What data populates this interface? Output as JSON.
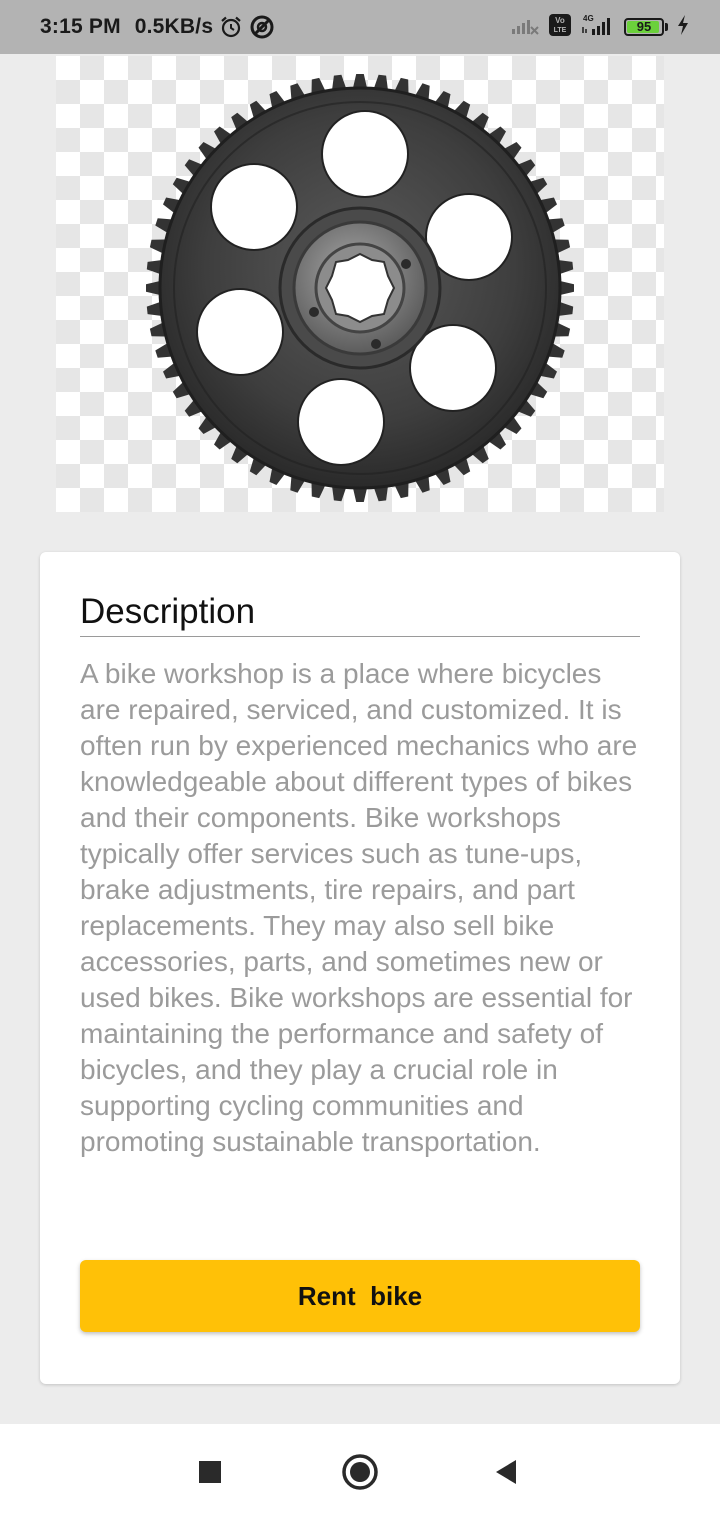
{
  "status_bar": {
    "time": "3:15 PM",
    "network_speed": "0.5KB/s",
    "network_type": "4G",
    "volte_label": "Vo LTE",
    "battery_level": "95",
    "icons": [
      "alarm-icon",
      "vpn-icon",
      "signal-icon",
      "volte-icon",
      "signal-4g-icon",
      "battery-icon",
      "charging-icon"
    ]
  },
  "hero_image": {
    "subject": "gear-image"
  },
  "card": {
    "title": "Description",
    "description": "A bike workshop is a place where bicycles are repaired, serviced, and customized. It is often run by experienced mechanics who are knowledgeable about different types of bikes and their components. Bike workshops typically offer services such as tune-ups, brake adjustments, tire repairs, and part replacements. They may also sell bike accessories, parts, and sometimes new or used bikes. Bike workshops are essential for maintaining the performance and safety of bicycles, and they play a crucial role in supporting cycling communities and promoting sustainable transportation.",
    "button_label": "Rent  bike"
  },
  "nav_bar": {
    "icons": [
      "recent-apps-icon",
      "home-icon",
      "back-icon"
    ]
  },
  "colors": {
    "accent": "#ffc107",
    "status_bar": "#b3b3b3",
    "description_text": "#9b9b9b",
    "battery": "#6bd13b"
  }
}
